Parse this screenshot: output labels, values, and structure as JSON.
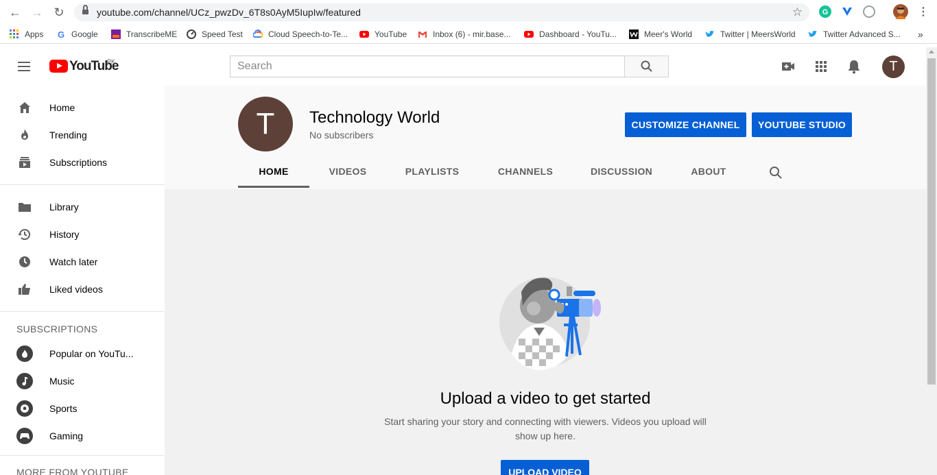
{
  "browser": {
    "url": "youtube.com/channel/UCz_pwzDv_6T8s0AyM5IupIw/featured",
    "bookmarks": [
      {
        "label": "Apps",
        "icon": "apps-grid-icon"
      },
      {
        "label": "Google",
        "icon": "google-icon"
      },
      {
        "label": "TranscribeME",
        "icon": "transcribeme-icon"
      },
      {
        "label": "Speed Test",
        "icon": "speedtest-icon"
      },
      {
        "label": "Cloud Speech-to-Te...",
        "icon": "google-cloud-icon"
      },
      {
        "label": "YouTube",
        "icon": "youtube-icon"
      },
      {
        "label": "Inbox (6) - mir.base...",
        "icon": "gmail-icon"
      },
      {
        "label": "Dashboard - YouTu...",
        "icon": "youtube-icon"
      },
      {
        "label": "Meer's World",
        "icon": "meers-world-icon"
      },
      {
        "label": "Twitter | MeersWorld",
        "icon": "twitter-icon"
      },
      {
        "label": "Twitter Advanced S...",
        "icon": "twitter-icon"
      }
    ],
    "more_bookmarks": "»"
  },
  "masthead": {
    "logo_text": "YouTube",
    "region": "PK",
    "search_placeholder": "Search",
    "avatar_letter": "T"
  },
  "sidebar": {
    "primary": [
      {
        "label": "Home",
        "icon": "home-icon"
      },
      {
        "label": "Trending",
        "icon": "trending-icon"
      },
      {
        "label": "Subscriptions",
        "icon": "subscriptions-icon"
      }
    ],
    "library": [
      {
        "label": "Library",
        "icon": "library-icon"
      },
      {
        "label": "History",
        "icon": "history-icon"
      },
      {
        "label": "Watch later",
        "icon": "watch-later-icon"
      },
      {
        "label": "Liked videos",
        "icon": "liked-videos-icon"
      }
    ],
    "subscriptions_heading": "SUBSCRIPTIONS",
    "subscriptions": [
      {
        "label": "Popular on YouTu...",
        "icon": "popular-icon"
      },
      {
        "label": "Music",
        "icon": "music-icon"
      },
      {
        "label": "Sports",
        "icon": "sports-icon"
      },
      {
        "label": "Gaming",
        "icon": "gaming-icon"
      }
    ],
    "more_heading": "MORE FROM YOUTUBE"
  },
  "channel": {
    "avatar_letter": "T",
    "name": "Technology World",
    "subscribers": "No subscribers",
    "customize_label": "CUSTOMIZE CHANNEL",
    "studio_label": "YOUTUBE STUDIO",
    "tabs": [
      "HOME",
      "VIDEOS",
      "PLAYLISTS",
      "CHANNELS",
      "DISCUSSION",
      "ABOUT"
    ],
    "active_tab": "HOME"
  },
  "empty_state": {
    "title": "Upload a video to get started",
    "description": "Start sharing your story and connecting with viewers. Videos you upload will show up here.",
    "upload_label": "UPLOAD VIDEO"
  },
  "colors": {
    "brand_red": "#ff0000",
    "button_blue": "#065fd4",
    "avatar_brown": "#5d4037"
  }
}
